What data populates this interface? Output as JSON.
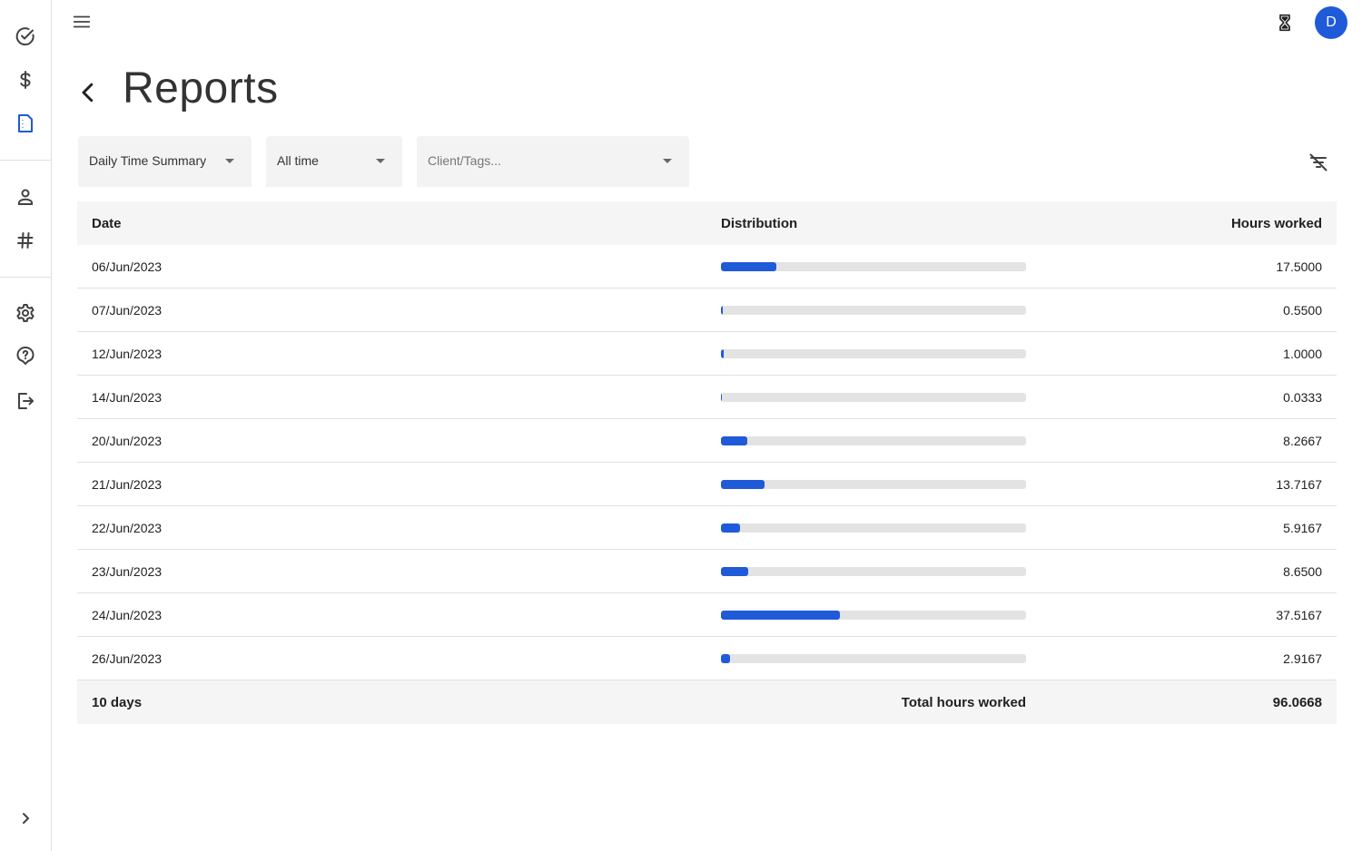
{
  "app": {
    "avatar_letter": "D",
    "accent": "#1f5ad9"
  },
  "rail": {
    "items": [
      {
        "icon": "check-circle-icon",
        "active": false
      },
      {
        "icon": "dollar-icon",
        "active": false
      },
      {
        "icon": "report-document-icon",
        "active": true
      },
      {
        "icon": "person-icon",
        "active": false
      },
      {
        "icon": "hashtag-icon",
        "active": false
      },
      {
        "icon": "gear-icon",
        "active": false
      },
      {
        "icon": "help-icon",
        "active": false
      },
      {
        "icon": "logout-icon",
        "active": false
      },
      {
        "icon": "chevron-right-icon",
        "active": false
      }
    ]
  },
  "header": {
    "title": "Reports"
  },
  "filters": {
    "report_type": "Daily Time Summary",
    "period": "All time",
    "client_tags_placeholder": "Client/Tags..."
  },
  "table": {
    "headers": {
      "date": "Date",
      "distribution": "Distribution",
      "hours": "Hours worked"
    },
    "max_hours": 96.0668,
    "rows": [
      {
        "date": "06/Jun/2023",
        "hours": "17.5000",
        "value": 17.5
      },
      {
        "date": "07/Jun/2023",
        "hours": "0.5500",
        "value": 0.55
      },
      {
        "date": "12/Jun/2023",
        "hours": "1.0000",
        "value": 1.0
      },
      {
        "date": "14/Jun/2023",
        "hours": "0.0333",
        "value": 0.0333
      },
      {
        "date": "20/Jun/2023",
        "hours": "8.2667",
        "value": 8.2667
      },
      {
        "date": "21/Jun/2023",
        "hours": "13.7167",
        "value": 13.7167
      },
      {
        "date": "22/Jun/2023",
        "hours": "5.9167",
        "value": 5.9167
      },
      {
        "date": "23/Jun/2023",
        "hours": "8.6500",
        "value": 8.65
      },
      {
        "date": "24/Jun/2023",
        "hours": "37.5167",
        "value": 37.5167
      },
      {
        "date": "26/Jun/2023",
        "hours": "2.9167",
        "value": 2.9167
      }
    ],
    "footer": {
      "days": "10 days",
      "total_label": "Total hours worked",
      "total": "96.0668"
    }
  }
}
